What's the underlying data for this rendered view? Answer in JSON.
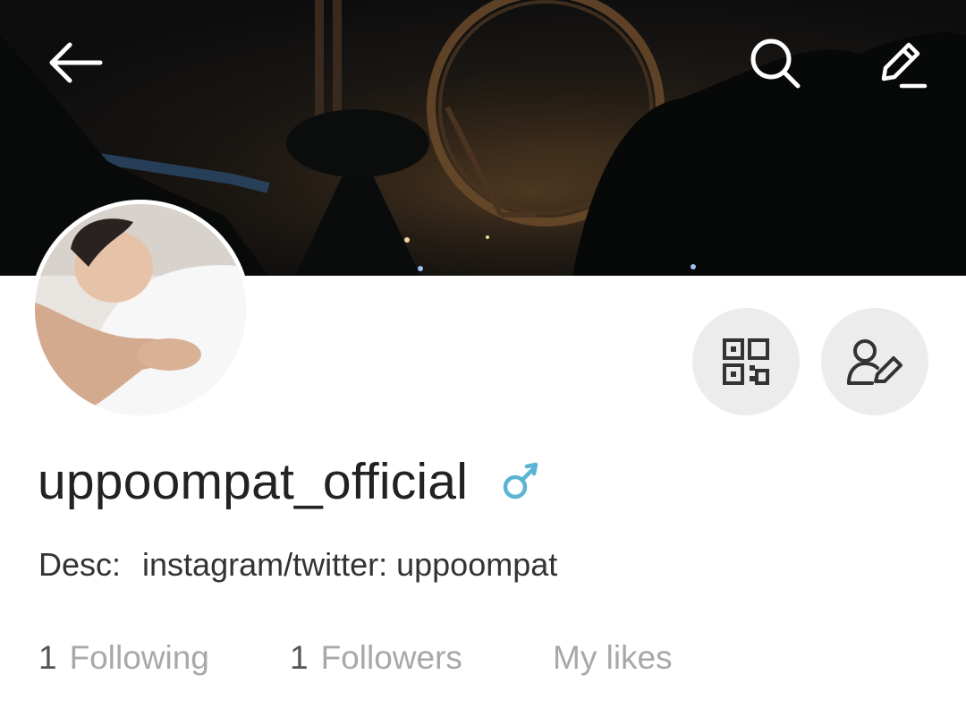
{
  "header": {
    "back_icon": "arrow-left-icon",
    "search_icon": "search-icon",
    "edit_icon": "pencil-icon"
  },
  "profile": {
    "username": "uppoompat_official",
    "gender_icon": "male-icon",
    "gender_color": "#5bb4d4",
    "desc_label": "Desc:",
    "desc_value": "instagram/twitter: uppoompat",
    "actions": {
      "qr_icon": "qr-code-icon",
      "edit_profile_icon": "user-edit-icon"
    }
  },
  "stats": {
    "following_count": "1",
    "following_label": "Following",
    "followers_count": "1",
    "followers_label": "Followers",
    "likes_label": "My likes"
  }
}
